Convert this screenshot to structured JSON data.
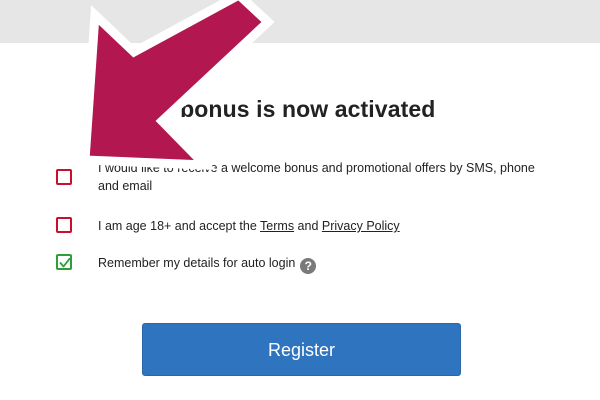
{
  "header": {
    "title_visible": "r bonus is now activated"
  },
  "options": [
    {
      "text": "I would like to receive a welcome bonus and promotional offers by SMS, phone and email",
      "checked": false
    },
    {
      "prefix": "I am age 18+ and accept the ",
      "terms_link": "Terms",
      "middle": " and ",
      "privacy_link": "Privacy Policy",
      "checked": false
    },
    {
      "text": "Remember my details for auto login",
      "checked": true,
      "help_icon": "question-circle-icon"
    }
  ],
  "register": {
    "label": "Register"
  },
  "colors": {
    "unchecked_border": "#c8102e",
    "checked": "#2e9e3a",
    "button": "#2f74bf",
    "arrow": "#b3174f"
  }
}
